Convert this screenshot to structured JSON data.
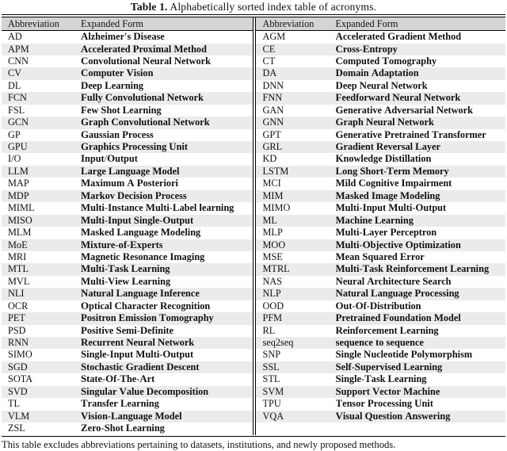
{
  "caption": {
    "label": "Table 1.",
    "text": "Alphabetically sorted index table of acronyms."
  },
  "table": {
    "headers": {
      "abbreviation": "Abbreviation",
      "expanded_form": "Expanded Form"
    },
    "left_column": [
      {
        "abbr": "AD",
        "exp": "Alzheimer's Disease"
      },
      {
        "abbr": "APM",
        "exp": "Accelerated Proximal Method"
      },
      {
        "abbr": "CNN",
        "exp": "Convolutional Neural Network"
      },
      {
        "abbr": "CV",
        "exp": "Computer Vision"
      },
      {
        "abbr": "DL",
        "exp": "Deep Learning"
      },
      {
        "abbr": "FCN",
        "exp": "Fully Convolutional Network"
      },
      {
        "abbr": "FSL",
        "exp": "Few Shot Learning"
      },
      {
        "abbr": "GCN",
        "exp": "Graph Convolutional Network"
      },
      {
        "abbr": "GP",
        "exp": "Gaussian Process"
      },
      {
        "abbr": "GPU",
        "exp": "Graphics Processing Unit"
      },
      {
        "abbr": "I/O",
        "exp": "Input/Output"
      },
      {
        "abbr": "LLM",
        "exp": "Large Language Model"
      },
      {
        "abbr": "MAP",
        "exp": "Maximum A Posteriori"
      },
      {
        "abbr": "MDP",
        "exp": "Markov Decision Process"
      },
      {
        "abbr": "MIML",
        "exp": "Multi-Instance Multi-Label learning"
      },
      {
        "abbr": "MISO",
        "exp": "Multi-Input Single-Output"
      },
      {
        "abbr": "MLM",
        "exp": "Masked Language Modeling"
      },
      {
        "abbr": "MoE",
        "exp": "Mixture-of-Experts"
      },
      {
        "abbr": "MRI",
        "exp": "Magnetic Resonance Imaging"
      },
      {
        "abbr": "MTL",
        "exp": "Multi-Task Learning"
      },
      {
        "abbr": "MVL",
        "exp": "Multi-View Learning"
      },
      {
        "abbr": "NLI",
        "exp": "Natural Language Inference"
      },
      {
        "abbr": "OCR",
        "exp": "Optical Character Recognition"
      },
      {
        "abbr": "PET",
        "exp": "Positron Emission Tomography"
      },
      {
        "abbr": "PSD",
        "exp": "Positive Semi-Definite"
      },
      {
        "abbr": "RNN",
        "exp": "Recurrent Neural Network"
      },
      {
        "abbr": "SIMO",
        "exp": "Single-Input Multi-Output"
      },
      {
        "abbr": "SGD",
        "exp": "Stochastic Gradient Descent"
      },
      {
        "abbr": "SOTA",
        "exp": "State-Of-The-Art"
      },
      {
        "abbr": "SVD",
        "exp": "Singular Value Decomposition"
      },
      {
        "abbr": "TL",
        "exp": "Transfer Learning"
      },
      {
        "abbr": "VLM",
        "exp": "Vision-Language Model"
      },
      {
        "abbr": "ZSL",
        "exp": "Zero-Shot Learning"
      }
    ],
    "right_column": [
      {
        "abbr": "AGM",
        "exp": "Accelerated Gradient Method"
      },
      {
        "abbr": "CE",
        "exp": "Cross-Entropy"
      },
      {
        "abbr": "CT",
        "exp": "Computed Tomography"
      },
      {
        "abbr": "DA",
        "exp": "Domain Adaptation"
      },
      {
        "abbr": "DNN",
        "exp": "Deep Neural Network"
      },
      {
        "abbr": "FNN",
        "exp": "Feedforward Neural Network"
      },
      {
        "abbr": "GAN",
        "exp": "Generative Adversarial Network"
      },
      {
        "abbr": "GNN",
        "exp": "Graph Neural Network"
      },
      {
        "abbr": "GPT",
        "exp": "Generative Pretrained Transformer"
      },
      {
        "abbr": "GRL",
        "exp": "Gradient Reversal Layer"
      },
      {
        "abbr": "KD",
        "exp": "Knowledge Distillation"
      },
      {
        "abbr": "LSTM",
        "exp": "Long Short-Term Memory"
      },
      {
        "abbr": "MCI",
        "exp": "Mild Cognitive Impairment"
      },
      {
        "abbr": "MIM",
        "exp": "Masked Image Modeling"
      },
      {
        "abbr": "MIMO",
        "exp": "Multi-Input Multi-Output"
      },
      {
        "abbr": "ML",
        "exp": "Machine Learning"
      },
      {
        "abbr": "MLP",
        "exp": "Multi-Layer Perceptron"
      },
      {
        "abbr": "MOO",
        "exp": "Multi-Objective Optimization"
      },
      {
        "abbr": "MSE",
        "exp": "Mean Squared Error"
      },
      {
        "abbr": "MTRL",
        "exp": "Multi-Task Reinforcement Learning"
      },
      {
        "abbr": "NAS",
        "exp": "Neural Architecture Search"
      },
      {
        "abbr": "NLP",
        "exp": "Natural Language Processing"
      },
      {
        "abbr": "OOD",
        "exp": "Out-Of-Distribution"
      },
      {
        "abbr": "PFM",
        "exp": "Pretrained Foundation Model"
      },
      {
        "abbr": "RL",
        "exp": "Reinforcement Learning"
      },
      {
        "abbr": "seq2seq",
        "exp": "sequence to sequence"
      },
      {
        "abbr": "SNP",
        "exp": "Single Nucleotide Polymorphism"
      },
      {
        "abbr": "SSL",
        "exp": "Self-Supervised Learning"
      },
      {
        "abbr": "STL",
        "exp": "Single-Task Learning"
      },
      {
        "abbr": "SVM",
        "exp": "Support Vector Machine"
      },
      {
        "abbr": "TPU",
        "exp": "Tensor Processing Unit"
      },
      {
        "abbr": "VQA",
        "exp": "Visual Question Answering"
      }
    ],
    "right_column_trailing_blanks": 1
  },
  "footnote": "This table excludes abbreviations pertaining to datasets, institutions, and newly proposed methods.",
  "style": {
    "header_bg": "#d4d4d4",
    "stripe_bg": "#ebebeb",
    "row_bg": "#ffffff",
    "rule_color": "#000000",
    "text_color": "#111111"
  }
}
